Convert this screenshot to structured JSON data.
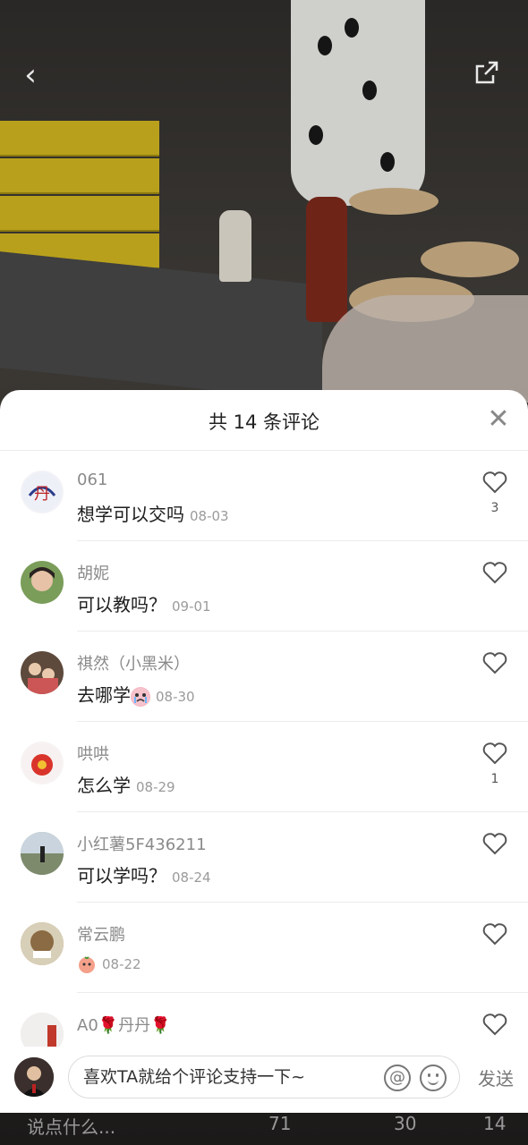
{
  "sheet": {
    "title": "共 14 条评论",
    "close_icon": "close-icon"
  },
  "comments": [
    {
      "name": "061",
      "text": "想学可以交吗",
      "date": "08-03",
      "likes": "3",
      "avatar_color": "#f2f2f7"
    },
    {
      "name": "胡妮",
      "text": "可以教吗？",
      "date": "09-01",
      "likes": "",
      "avatar_color": "#7a9d5a"
    },
    {
      "name": "祺然（小黑米）",
      "text": "去哪学",
      "date": "08-30",
      "likes": "",
      "emoji": "crying-face-emoji",
      "avatar_color": "#5d4a3c"
    },
    {
      "name": "哄哄",
      "text": "怎么学",
      "date": "08-29",
      "likes": "1",
      "avatar_color": "#f7f3f3"
    },
    {
      "name": "小红薯5F436211",
      "text": "可以学吗？",
      "date": "08-24",
      "likes": "",
      "avatar_color": "#8a9a84"
    },
    {
      "name": "常云鹏",
      "text": "",
      "date": "08-22",
      "likes": "",
      "emoji": "peach-emoji",
      "avatar_color": "#b69a6a"
    },
    {
      "name": "A0🌹丹丹🌹",
      "text": "",
      "date": "",
      "likes": "",
      "avatar_color": "#e8e1e2"
    }
  ],
  "input": {
    "placeholder": "喜欢TA就给个评论支持一下~",
    "at_label": "@",
    "send_label": "发送"
  },
  "bottom_bar": {
    "say_label": "说点什么...",
    "likes": "71",
    "stars": "30",
    "comments": "14"
  },
  "colors": {
    "sheet_bg": "#ffffff",
    "name_text": "#8a8a8a",
    "body_text": "#1d1d1d"
  }
}
